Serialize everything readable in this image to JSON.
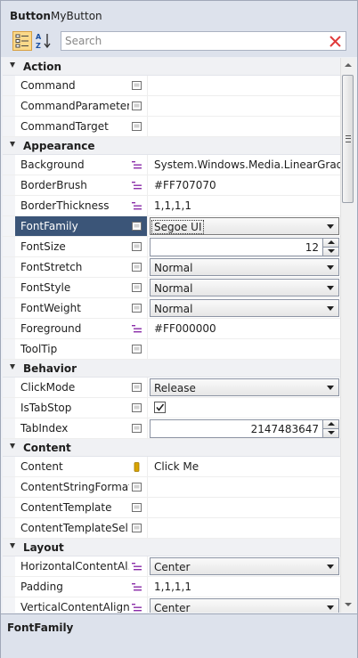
{
  "header": {
    "type_label": "Button",
    "object_name": "MyButton"
  },
  "toolbar": {
    "categorize_icon": "categorize-icon",
    "alphabetical_icon": "sort-az-icon"
  },
  "search": {
    "placeholder": "Search",
    "value": "",
    "clear_icon": "clear-x-icon",
    "clear_color": "#e03a3a"
  },
  "colors": {
    "selected_row": "#3b5578",
    "resource_marker": "#8a2da8",
    "local_marker": "#d8a300",
    "panel_background": "#dde2ec"
  },
  "categories": [
    {
      "name": "Action",
      "props": [
        {
          "name": "Command",
          "marker": "default",
          "value": "",
          "editor": "text"
        },
        {
          "name": "CommandParameter",
          "marker": "default",
          "value": "",
          "editor": "text"
        },
        {
          "name": "CommandTarget",
          "marker": "default",
          "value": "",
          "editor": "text"
        }
      ]
    },
    {
      "name": "Appearance",
      "props": [
        {
          "name": "Background",
          "marker": "resource",
          "value": "System.Windows.Media.LinearGradient",
          "editor": "text"
        },
        {
          "name": "BorderBrush",
          "marker": "resource",
          "value": "#FF707070",
          "editor": "text"
        },
        {
          "name": "BorderThickness",
          "marker": "resource",
          "value": "1,1,1,1",
          "editor": "text"
        },
        {
          "name": "FontFamily",
          "marker": "default",
          "value": "Segoe UI",
          "editor": "dropdown",
          "selected": true
        },
        {
          "name": "FontSize",
          "marker": "default",
          "value": "12",
          "editor": "stepper"
        },
        {
          "name": "FontStretch",
          "marker": "default",
          "value": "Normal",
          "editor": "dropdown"
        },
        {
          "name": "FontStyle",
          "marker": "default",
          "value": "Normal",
          "editor": "dropdown"
        },
        {
          "name": "FontWeight",
          "marker": "default",
          "value": "Normal",
          "editor": "dropdown"
        },
        {
          "name": "Foreground",
          "marker": "resource",
          "value": "#FF000000",
          "editor": "text"
        },
        {
          "name": "ToolTip",
          "marker": "default",
          "value": "",
          "editor": "text"
        }
      ]
    },
    {
      "name": "Behavior",
      "props": [
        {
          "name": "ClickMode",
          "marker": "default",
          "value": "Release",
          "editor": "dropdown"
        },
        {
          "name": "IsTabStop",
          "marker": "default",
          "value": "",
          "editor": "checkbox",
          "checked": true
        },
        {
          "name": "TabIndex",
          "marker": "default",
          "value": "2147483647",
          "editor": "stepper"
        }
      ]
    },
    {
      "name": "Content",
      "props": [
        {
          "name": "Content",
          "marker": "local",
          "value": "Click Me",
          "editor": "text"
        },
        {
          "name": "ContentStringFormat",
          "marker": "default",
          "value": "",
          "editor": "text"
        },
        {
          "name": "ContentTemplate",
          "marker": "default",
          "value": "",
          "editor": "text"
        },
        {
          "name": "ContentTemplateSel...",
          "marker": "default",
          "value": "",
          "editor": "text"
        }
      ]
    },
    {
      "name": "Layout",
      "props": [
        {
          "name": "HorizontalContentAl...",
          "marker": "resource",
          "value": "Center",
          "editor": "dropdown"
        },
        {
          "name": "Padding",
          "marker": "resource",
          "value": "1,1,1,1",
          "editor": "text"
        },
        {
          "name": "VerticalContentAlign...",
          "marker": "resource",
          "value": "Center",
          "editor": "dropdown"
        }
      ]
    }
  ],
  "footer": {
    "title": "FontFamily"
  }
}
